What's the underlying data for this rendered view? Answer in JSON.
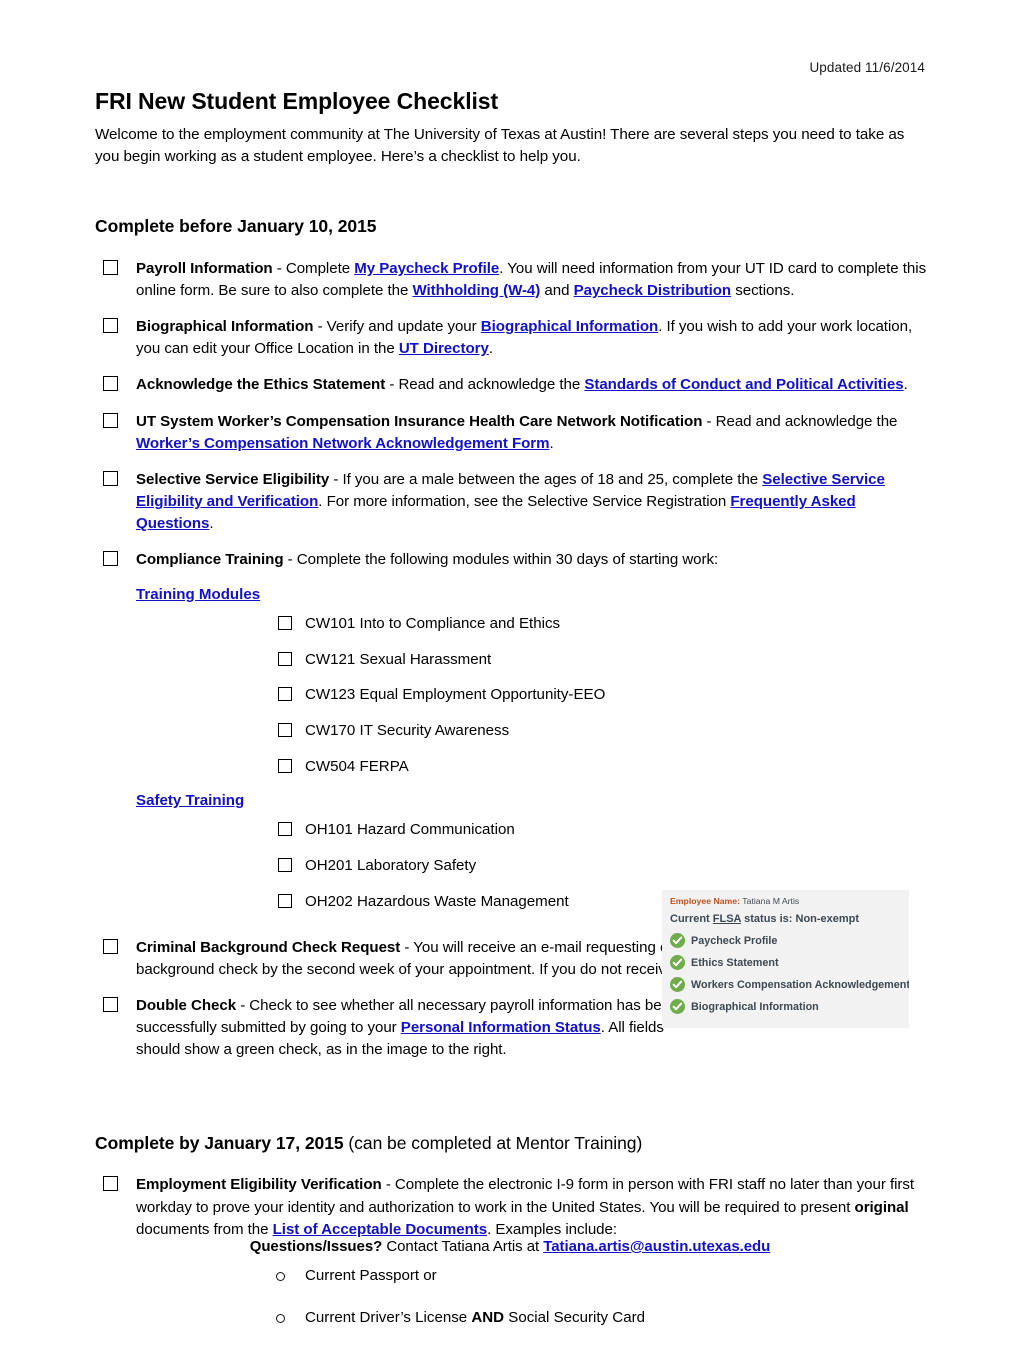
{
  "header": {
    "updated": "Updated 11/6/2014",
    "title": "FRI New Student Employee Checklist",
    "intro": "Welcome to the employment community at The University of Texas at Austin! There are several steps you need to take as you begin working as a student employee. Here’s a checklist to help you."
  },
  "section1": {
    "heading": "Complete before January 10, 2015",
    "items": {
      "payroll": {
        "label": "Payroll Information",
        "t1": " - Complete ",
        "link1": "My Paycheck Profile",
        "t2": ". You will need information from your UT ID card to complete this online form. Be sure to also complete the ",
        "link2": "Withholding (W-4)",
        "t3": " and ",
        "link3": "Paycheck Distribution",
        "t4": " sections."
      },
      "biographical": {
        "label": "Biographical Information",
        "t1": " - Verify and update your ",
        "link1": "Biographical Information",
        "t2": ". If you wish to add your work location, you can edit your Office Location in the ",
        "link2": "UT Directory",
        "t3": "."
      },
      "ethics": {
        "label": "Acknowledge the Ethics Statement",
        "t1": " - Read and acknowledge the ",
        "link1": "Standards of Conduct and Political Activities",
        "t2": "."
      },
      "workerscomp": {
        "label": "UT System Worker’s Compensation Insurance Health Care Network Notification",
        "t1": " - Read and acknowledge the ",
        "link1": "Worker’s Compensation Network Acknowledgement Form",
        "t2": "."
      },
      "selective": {
        "label": "Selective Service Eligibility",
        "t1": " - If you are a male between the ages of 18 and 25, complete the ",
        "link1": "Selective Service Eligibility and Verification",
        "t2": ". For more information, see the Selective Service Registration ",
        "link2": "Frequently Asked Questions",
        "t3": "."
      },
      "compliance": {
        "label": "Compliance Training",
        "t1": " - Complete the following modules within 30 days of starting work:"
      },
      "background": {
        "label": "Criminal Background Check Request",
        "t1": " - You will receive an e-mail requesting electronic authorization to conduct a background check by the second week of your appointment. If you do not receive the email, please contact us."
      },
      "doublecheck": {
        "label": "Double Check",
        "t1": " - Check to see whether all necessary payroll information has been successfully submitted by going to your ",
        "link1": "Personal Information Status",
        "t2": ". All fields should show a green check, as in the image to the right."
      }
    },
    "training_modules_link": "Training Modules",
    "training_modules": [
      "CW101 Into to Compliance and Ethics",
      "CW121 Sexual Harassment",
      "CW123 Equal Employment Opportunity-EEO",
      "CW170 IT Security Awareness",
      "CW504 FERPA"
    ],
    "safety_training_link": "Safety Training",
    "safety_training": [
      "OH101 Hazard Communication",
      "OH201 Laboratory Safety",
      "OH202 Hazardous Waste Management"
    ]
  },
  "status_image": {
    "employee_name_label": "Employee Name:",
    "employee_name_value": " Tatiana M Artis",
    "flsa_prefix": "Current ",
    "flsa_underlined": "FLSA",
    "flsa_suffix": " status is: Non-exempt",
    "rows": [
      "Paycheck Profile",
      "Ethics Statement",
      "Workers Compensation Acknowledgement",
      "Biographical Information"
    ],
    "check_color": "#70ab4c",
    "label_color": "#c1501e",
    "bg_color": "#f2f2f2"
  },
  "section2": {
    "heading_bold": "Complete by January 17, 2015",
    "heading_normal": " (can be completed at Mentor Training)",
    "i9": {
      "label": "Employment Eligibility Verification",
      "t1": " - Complete the electronic I-9 form in person with FRI staff no later than your first workday to prove your identity and authorization to work in the United States. You will be required to present ",
      "bold1": "original",
      "t2": " documents from the ",
      "link1": "List of Acceptable Documents",
      "t3": ". Examples include:"
    },
    "examples": [
      {
        "pre": "Current Passport or",
        "bold": "",
        "post": ""
      },
      {
        "pre": "Current Driver’s License ",
        "bold": "AND",
        "post": " Social Security Card"
      }
    ]
  },
  "footer": {
    "bold": "Questions/Issues?",
    "text": " Contact Tatiana Artis at ",
    "email": "Tatiana.artis@austin.utexas.edu"
  }
}
